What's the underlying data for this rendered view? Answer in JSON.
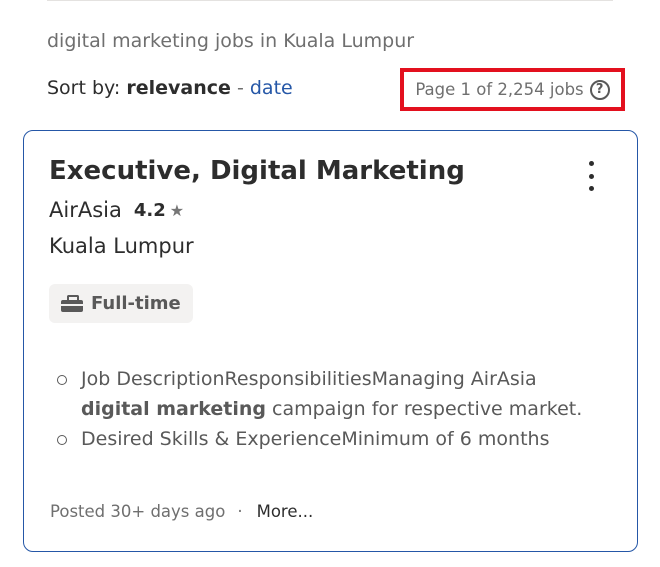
{
  "search": {
    "heading": "digital marketing jobs in Kuala Lumpur"
  },
  "sort": {
    "prefix": "Sort by:",
    "active": "relevance",
    "separator": "-",
    "alternative": "date"
  },
  "results": {
    "page_count": "Page 1 of 2,254 jobs",
    "help_glyph": "?"
  },
  "job": {
    "title": "Executive, Digital Marketing",
    "company": "AirAsia",
    "rating": "4.2",
    "rating_glyph": "★",
    "location": "Kuala Lumpur",
    "job_type": "Full-time",
    "snippet": {
      "line1_prefix": "Job DescriptionResponsibilitiesManaging AirAsia ",
      "line1_highlight": "digital marketing",
      "line1_suffix": " campaign for respective market.",
      "line2": "Desired Skills & ExperienceMinimum of 6 months"
    },
    "posted": "Posted 30+ days ago",
    "dot": "·",
    "more_label": "More..."
  },
  "icons": {
    "help": "help-circle-icon",
    "star": "star-icon",
    "briefcase": "briefcase-icon",
    "menu": "more-vertical-icon"
  },
  "colors": {
    "link": "#2557a7",
    "highlight_box": "#e3101e",
    "card_border": "#2557a7"
  }
}
